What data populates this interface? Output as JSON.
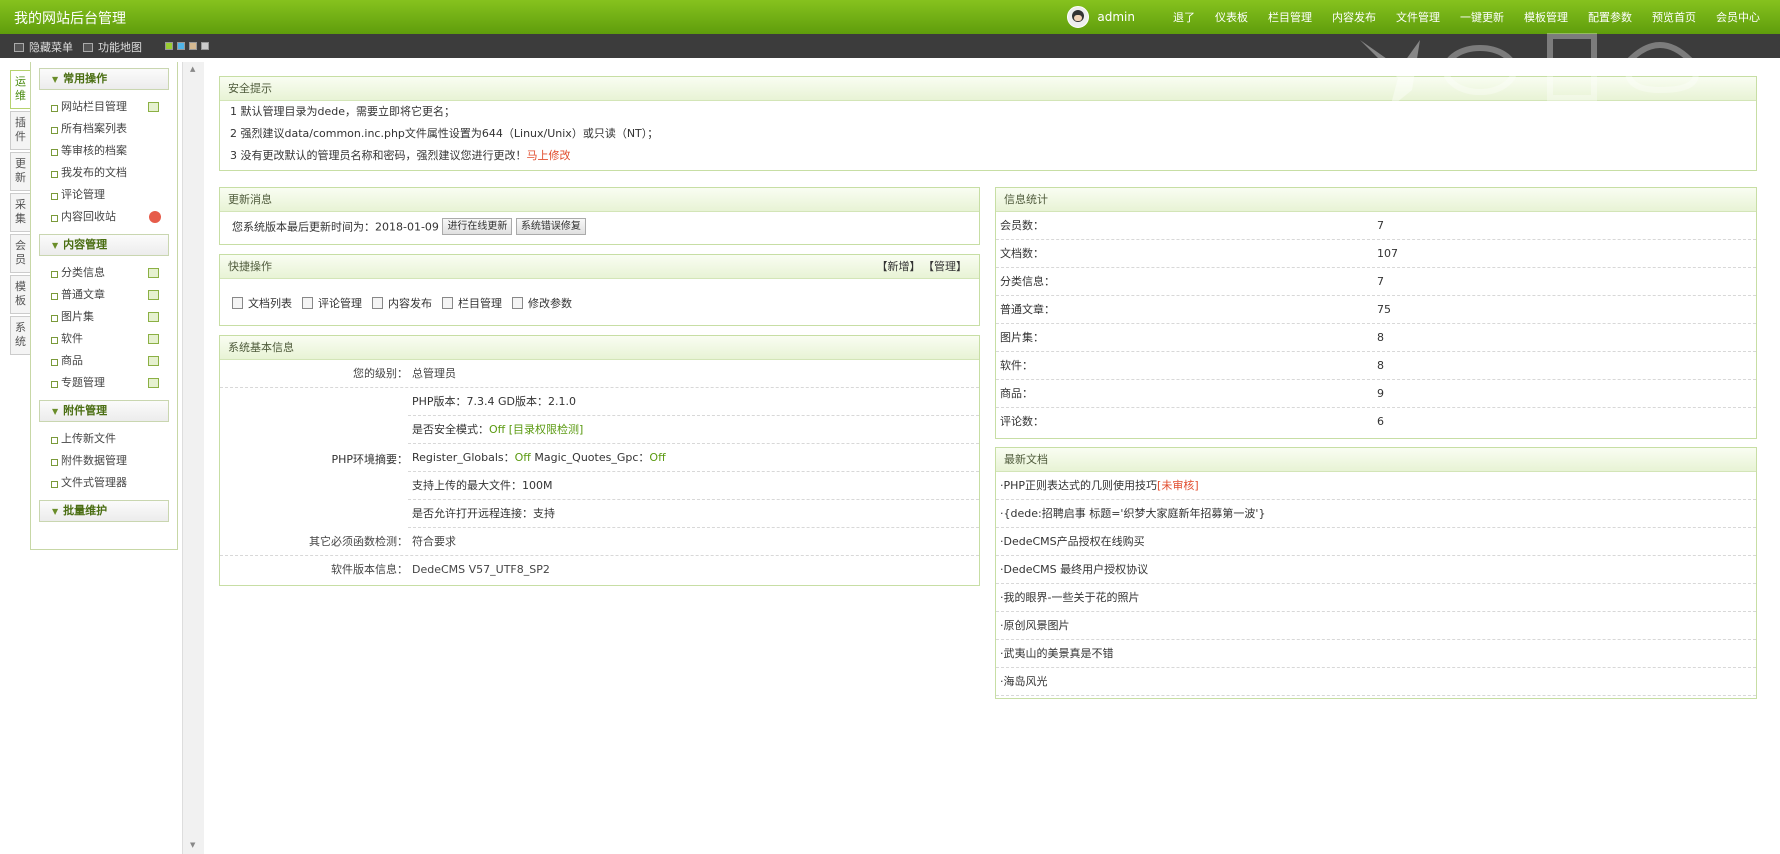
{
  "app": {
    "title": "我的网站后台管理"
  },
  "user": {
    "name": "admin"
  },
  "top_nav": [
    "退了",
    "仪表板",
    "栏目管理",
    "内容发布",
    "文件管理",
    "一键更新",
    "模板管理",
    "配置参数",
    "预览首页",
    "会员中心"
  ],
  "toolbar": {
    "hide_menu": "隐藏菜单",
    "site_map": "功能地图"
  },
  "theme_swatches": [
    "#9acd32",
    "#4fb4e8",
    "#d4b890",
    "#cccccc"
  ],
  "side_tabs": [
    "运维",
    "插件",
    "更新",
    "采集",
    "会员",
    "模板",
    "系统"
  ],
  "menu": {
    "groups": [
      {
        "title": "常用操作",
        "items": [
          {
            "label": "网站栏目管理",
            "icon": "add"
          },
          {
            "label": "所有档案列表",
            "icon": ""
          },
          {
            "label": "等审核的档案",
            "icon": ""
          },
          {
            "label": "我发布的文档",
            "icon": ""
          },
          {
            "label": "评论管理",
            "icon": ""
          },
          {
            "label": "内容回收站",
            "icon": "delete"
          }
        ]
      },
      {
        "title": "内容管理",
        "items": [
          {
            "label": "分类信息",
            "icon": "add"
          },
          {
            "label": "普通文章",
            "icon": "add"
          },
          {
            "label": "图片集",
            "icon": "add"
          },
          {
            "label": "软件",
            "icon": "add"
          },
          {
            "label": "商品",
            "icon": "add"
          },
          {
            "label": "专题管理",
            "icon": "add"
          }
        ]
      },
      {
        "title": "附件管理",
        "items": [
          {
            "label": "上传新文件",
            "icon": ""
          },
          {
            "label": "附件数据管理",
            "icon": ""
          },
          {
            "label": "文件式管理器",
            "icon": ""
          }
        ]
      },
      {
        "title": "批量维护",
        "items": []
      }
    ]
  },
  "security": {
    "title": "安全提示",
    "lines": [
      "1 默认管理目录为dede，需要立即将它更名；",
      "2 强烈建议data/common.inc.php文件属性设置为644（Linux/Unix）或只读（NT）；",
      "3 没有更改默认的管理员名称和密码，强烈建议您进行更改！"
    ],
    "link": "马上修改"
  },
  "update": {
    "title": "更新消息",
    "text": "您系统版本最后更新时间为：2018-01-09",
    "btn_update": "进行在线更新",
    "btn_repair": "系统错误修复"
  },
  "quick": {
    "title": "快捷操作",
    "act_add": "【新增】",
    "act_manage": "【管理】",
    "items": [
      "文档列表",
      "评论管理",
      "内容发布",
      "栏目管理",
      "修改参数"
    ]
  },
  "sysinfo": {
    "title": "系统基本信息",
    "level_k": "您的级别：",
    "level_v": "总管理员",
    "php_k": "PHP环境摘要：",
    "php_version": "PHP版本：7.3.4  GD版本：2.1.0",
    "safe_mode_k": "是否安全模式：",
    "safe_mode_v": "Off",
    "safe_check": "[目录权限检测]",
    "rg_k": "Register_Globals：",
    "rg_v": "Off",
    "mq_k": "Magic_Quotes_Gpc：",
    "mq_v": "Off",
    "upload": "支持上传的最大文件：100M",
    "remote": "是否允许打开远程连接：支持",
    "func_k": "其它必须函数检测：",
    "func_v": "符合要求",
    "ver_k": "软件版本信息：",
    "ver_v": "DedeCMS V57_UTF8_SP2"
  },
  "stats": {
    "title": "信息统计",
    "rows": [
      {
        "k": "会员数：",
        "v": "7"
      },
      {
        "k": "文档数：",
        "v": "107"
      },
      {
        "k": "分类信息：",
        "v": "7"
      },
      {
        "k": "普通文章：",
        "v": "75"
      },
      {
        "k": "图片集：",
        "v": "8"
      },
      {
        "k": "软件：",
        "v": "8"
      },
      {
        "k": "商品：",
        "v": "9"
      },
      {
        "k": "评论数：",
        "v": "6"
      }
    ]
  },
  "latest": {
    "title": "最新文档",
    "items": [
      "·PHP正则表达式的几则使用技巧",
      "·{dede:招聘启事 标题='织梦大家庭新年招募第一波'}",
      "·DedeCMS产品授权在线购买",
      "·DedeCMS 最终用户授权协议",
      "·我的眼界-一些关于花的照片",
      "·原创风景图片",
      "·武夷山的美景真是不错",
      "·海岛风光"
    ],
    "pending": "[未审核]"
  }
}
